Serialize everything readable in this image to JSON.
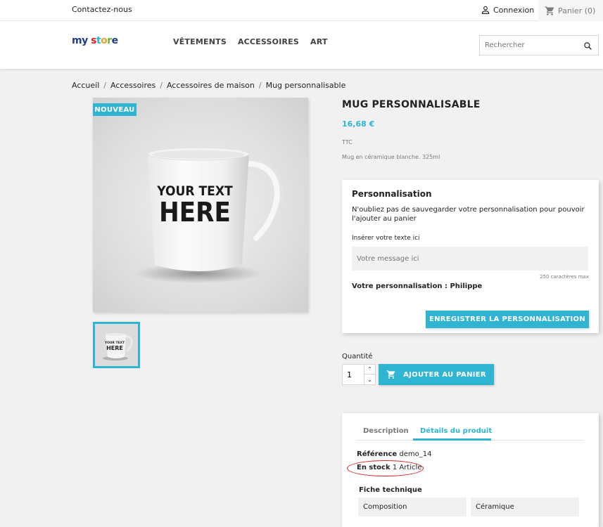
{
  "topbar": {
    "contact_label": "Contactez-nous",
    "login_label": "Connexion",
    "cart_label": "Panier (0)"
  },
  "header": {
    "logo": {
      "word1": "my",
      "word2_parts": [
        "s",
        "t",
        "o",
        "r",
        "e"
      ]
    },
    "nav": [
      "VÊTEMENTS",
      "ACCESSOIRES",
      "ART"
    ],
    "search_placeholder": "Rechercher"
  },
  "breadcrumb": [
    "Accueil",
    "Accessoires",
    "Accessoires de maison",
    "Mug personnalisable"
  ],
  "product": {
    "badge": "NOUVEAU",
    "title": "MUG PERSONNALISABLE",
    "price": "16,68 €",
    "tax_label": "TTC",
    "short_description": "Mug en céramique blanche. 325ml",
    "mug_print_line1": "YOUR TEXT",
    "mug_print_line2": "HERE"
  },
  "customization": {
    "title": "Personnalisation",
    "notice": "N'oubliez pas de sauvegarder votre personnalisation pour pouvoir l'ajouter au panier",
    "field_label": "Insérer votre texte ici",
    "field_placeholder": "Votre message ici",
    "max_chars": "250 caractères max",
    "yours_label": "Votre personnalisation :",
    "yours_value": "Philippe",
    "save_button": "ENREGISTRER LA PERSONNALISATION"
  },
  "purchase": {
    "qty_label": "Quantité",
    "qty_value": "1",
    "add_button": "AJOUTER AU PANIER"
  },
  "details": {
    "tabs": [
      "Description",
      "Détails du produit"
    ],
    "active_tab": "Détails du produit",
    "reference_label": "Référence",
    "reference_value": "demo_14",
    "stock_label": "En stock",
    "stock_value": "1 Article",
    "datasheet_title": "Fiche technique",
    "datasheet": [
      {
        "name": "Composition",
        "value": "Céramique"
      }
    ]
  },
  "colors": {
    "accent": "#2fb5d2",
    "annotation": "#d42020"
  }
}
